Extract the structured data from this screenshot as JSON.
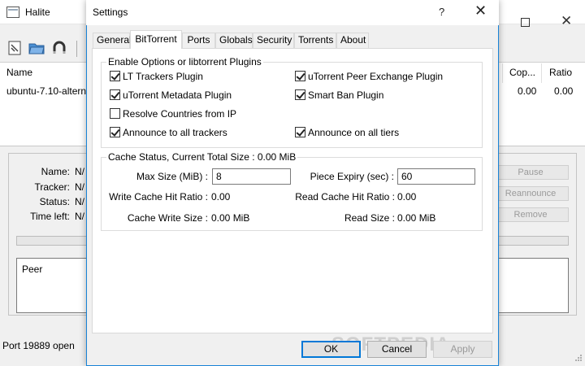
{
  "main": {
    "title": "Halite",
    "columns": [
      "Name",
      "Cop...",
      "Ratio"
    ],
    "row": {
      "name": "ubuntu-7.10-altern",
      "copies": "0.00",
      "ratio": "0.00"
    },
    "details": {
      "labels": [
        "Name:",
        "Tracker:",
        "Status:",
        "Time left:"
      ],
      "values": [
        "N/",
        "N/",
        "N/",
        "N/"
      ]
    },
    "side_buttons": [
      "Pause",
      "Reannounce",
      "Remove"
    ],
    "peer_header": "Peer",
    "status": "Port 19889 open"
  },
  "dialog": {
    "title": "Settings",
    "help_glyph": "?",
    "close_glyph": "✕",
    "tabs": [
      "General",
      "BitTorrent",
      "Ports",
      "Globals",
      "Security",
      "Torrents",
      "About"
    ],
    "active_tab": "BitTorrent",
    "plugins_group": {
      "title": "Enable Options or libtorrent Plugins",
      "options": [
        {
          "label": "LT Trackers Plugin",
          "checked": true
        },
        {
          "label": "uTorrent Peer Exchange Plugin",
          "checked": true
        },
        {
          "label": "uTorrent Metadata Plugin",
          "checked": true
        },
        {
          "label": "Smart Ban Plugin",
          "checked": true
        },
        {
          "label": "Resolve Countries from IP",
          "checked": false
        },
        {
          "label": "Announce to all trackers",
          "checked": true
        },
        {
          "label": "Announce on all tiers",
          "checked": true
        }
      ]
    },
    "cache_group": {
      "title": "Cache Status, Current Total Size : 0.00 MiB",
      "max_size_label": "Max Size (MiB) :",
      "max_size_value": "8",
      "piece_expiry_label": "Piece Expiry (sec) :",
      "piece_expiry_value": "60",
      "write_hit_label": "Write Cache Hit Ratio :",
      "write_hit_value": "0.00",
      "read_hit_label": "Read Cache Hit Ratio :",
      "read_hit_value": "0.00",
      "cache_write_label": "Cache Write Size :",
      "cache_write_value": "0.00 MiB",
      "read_size_label": "Read Size :",
      "read_size_value": "0.00 MiB"
    },
    "buttons": {
      "ok": "OK",
      "cancel": "Cancel",
      "apply": "Apply"
    },
    "watermark": "SOFTPEDIA"
  },
  "colors": {
    "accent": "#0078d7",
    "border": "#1883d7"
  }
}
